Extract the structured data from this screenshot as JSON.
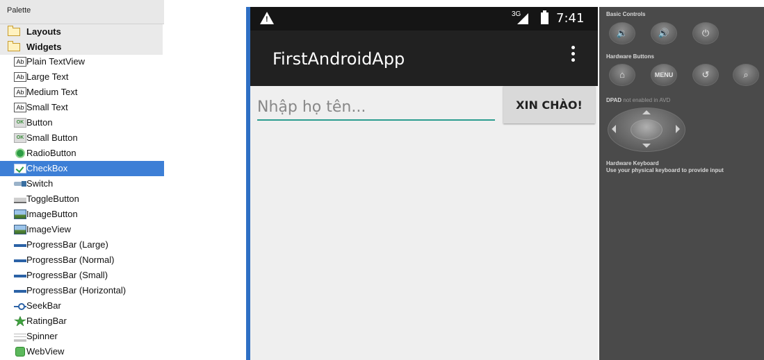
{
  "palette": {
    "title": "Palette",
    "groups": [
      {
        "label": "Layouts",
        "icon": "folder-icon"
      },
      {
        "label": "Widgets",
        "icon": "folder-icon"
      }
    ],
    "items": [
      {
        "label": "Plain TextView",
        "icon": "text-ab-icon"
      },
      {
        "label": "Large Text",
        "icon": "text-ab-icon"
      },
      {
        "label": "Medium Text",
        "icon": "text-ab-icon"
      },
      {
        "label": "Small Text",
        "icon": "text-ab-icon"
      },
      {
        "label": "Button",
        "icon": "button-ok-icon"
      },
      {
        "label": "Small Button",
        "icon": "button-ok-icon"
      },
      {
        "label": "RadioButton",
        "icon": "radio-icon"
      },
      {
        "label": "CheckBox",
        "icon": "checkbox-icon",
        "selected": true
      },
      {
        "label": "Switch",
        "icon": "switch-icon"
      },
      {
        "label": "ToggleButton",
        "icon": "toggle-icon"
      },
      {
        "label": "ImageButton",
        "icon": "image-icon"
      },
      {
        "label": "ImageView",
        "icon": "image-icon"
      },
      {
        "label": "ProgressBar (Large)",
        "icon": "progress-bar-icon"
      },
      {
        "label": "ProgressBar (Normal)",
        "icon": "progress-bar-icon"
      },
      {
        "label": "ProgressBar (Small)",
        "icon": "progress-bar-icon"
      },
      {
        "label": "ProgressBar (Horizontal)",
        "icon": "progress-bar-icon"
      },
      {
        "label": "SeekBar",
        "icon": "seekbar-icon"
      },
      {
        "label": "RatingBar",
        "icon": "star-icon"
      },
      {
        "label": "Spinner",
        "icon": "spinner-icon"
      },
      {
        "label": "WebView",
        "icon": "web-icon"
      }
    ],
    "ab_glyph": "Ab",
    "ok_glyph": "OK"
  },
  "device": {
    "status": {
      "network": "3G",
      "time": "7:41"
    },
    "app_title": "FirstAndroidApp",
    "input_placeholder": "Nhập họ tên...",
    "button_label": "XIN CHÀO!"
  },
  "emulator": {
    "basic_controls": "Basic Controls",
    "hardware_buttons": "Hardware Buttons",
    "menu_label": "MENU",
    "dpad_label": "DPAD",
    "dpad_note": "not enabled in AVD",
    "keyboard_title": "Hardware Keyboard",
    "keyboard_note": "Use your physical keyboard to provide input"
  },
  "colors": {
    "selection": "#3d7fd6",
    "divider": "#2e6fc4",
    "app_bar": "#212121",
    "input_underline": "#2a9d8f",
    "emulator_bg": "#4a4a4a"
  }
}
